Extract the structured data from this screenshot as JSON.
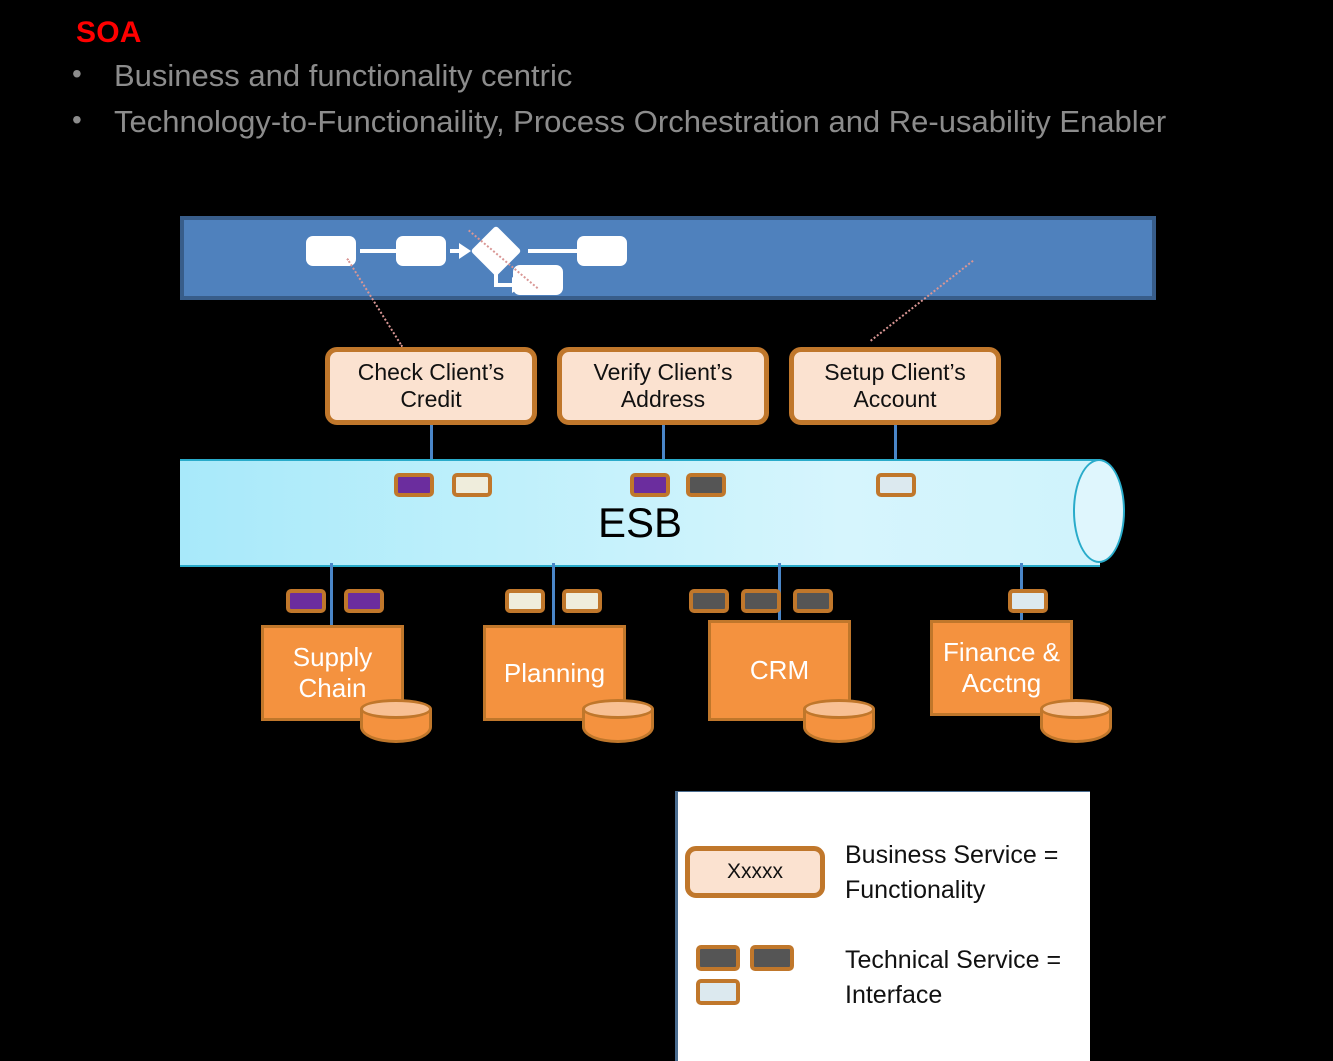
{
  "slide": {
    "title": "SOA",
    "title_color": "#FF0000",
    "bullet_marker": "•",
    "bullets": [
      "Business and functionality centric",
      "Technology-to-Functionaility, Process Orchestration and Re-usability Enabler"
    ]
  },
  "process_band": {
    "fill_color": "#4F81BD",
    "border_color": "#385D8A",
    "node_count": 5,
    "decision_shape": "diamond"
  },
  "business_services": [
    {
      "label": "Check Client’s Credit"
    },
    {
      "label": "Verify Client’s Address"
    },
    {
      "label": "Setup Client’s Account"
    }
  ],
  "esb": {
    "label": "ESB",
    "fill_color": "#BFF0FB",
    "outline_color": "#29ABCA",
    "top_badges": [
      {
        "group": 1,
        "colors": [
          "purple",
          "cream"
        ]
      },
      {
        "group": 2,
        "colors": [
          "purple",
          "gray"
        ]
      },
      {
        "group": 3,
        "colors": [
          "lblue"
        ]
      }
    ]
  },
  "systems": [
    {
      "label": "Supply Chain",
      "badges": [
        "purple",
        "purple"
      ]
    },
    {
      "label": "Planning",
      "badges": [
        "cream",
        "cream"
      ]
    },
    {
      "label": "CRM",
      "badges": [
        "gray",
        "gray",
        "gray"
      ]
    },
    {
      "label": "Finance & Acctng",
      "badges": [
        "lblue"
      ]
    }
  ],
  "legend": {
    "chip_label": "Xxxxx",
    "entries": [
      "Business Service = Functionality",
      "Technical Service = Interface"
    ],
    "badge_row_colors": [
      "gray",
      "gray"
    ],
    "badge_second_row_colors": [
      "lblue"
    ]
  },
  "colors": {
    "brand_orange": "#F4923F",
    "border_brown": "#C0772B",
    "service_fill": "#FBE2D0",
    "purple": "#6B2D9E",
    "cream": "#EFEDDC",
    "dark_gray": "#555555",
    "light_blue": "#DCE9EF",
    "connector_blue": "#4A86C8",
    "leader_pink": "#D99694",
    "bullet_gray": "#8C8C8C"
  }
}
